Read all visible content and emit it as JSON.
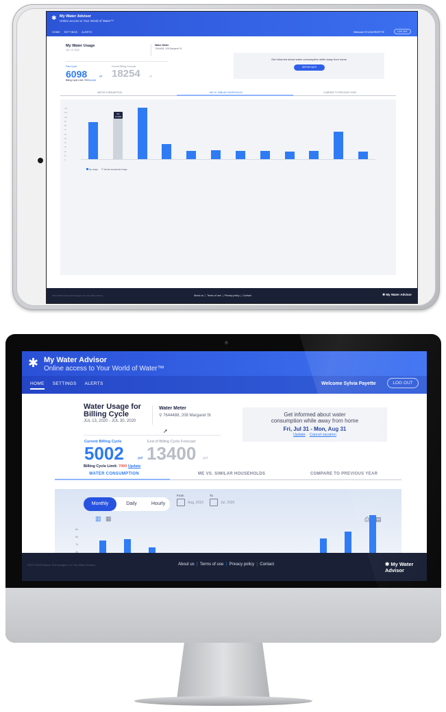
{
  "brand": {
    "app_name": "My Water Advisor",
    "tagline": "Online access to Your World of Water™"
  },
  "nav": {
    "items": [
      "HOME",
      "SETTINGS",
      "ALERTS"
    ],
    "welcome": "Welcome Sylvia Payette",
    "logout": "LOG OUT"
  },
  "usage": {
    "title": "Water Usage for Billing Cycle",
    "title_line1": "Water Usage for",
    "title_line2": "Billing Cycle",
    "date_range": "JUL 13, 2020 - JUL 30, 2020",
    "current_label": "Current Billing Cycle",
    "current_value": "5002",
    "current_unit": "gal",
    "forecast_label": "End of Billing Cycle Forecast",
    "forecast_value": "13400",
    "forecast_unit": "gal",
    "limit_label": "Billing Cycle Limit:",
    "limit_value": "7000",
    "limit_update": "Update"
  },
  "meter": {
    "label": "Water Meter",
    "address": "7644488, 208 Margaret St"
  },
  "vacation": {
    "text_line1": "Get informed about water",
    "text_line2": "consumption while away from home",
    "dates": "Fri, Jul 31 - Mon, Aug 31",
    "update": "Update",
    "cancel": "Cancel vacation"
  },
  "tabs": [
    "WATER CONSUMPTION",
    "ME VS. SIMILAR HOUSEHOLDS",
    "COMPARE TO PREVIOUS YEAR"
  ],
  "filters": {
    "periods": [
      "Monthly",
      "Daily",
      "Hourly"
    ],
    "from_label": "From",
    "from_value": "Aug, 2019",
    "to_label": "To",
    "to_value": "Jul, 2020"
  },
  "monitor_chart": {
    "yticks": [
      "8k",
      "6k",
      "7k",
      "4k"
    ],
    "values": [
      0.28,
      0.3,
      0.12,
      0.0,
      0.0,
      0.0,
      0.0,
      0.0,
      0.0,
      0.32,
      0.48,
      0.85
    ]
  },
  "tablet": {
    "usage_title": "My Water Usage",
    "usage_date": "JUL 13, 2020",
    "meter_label": "Water Meter",
    "meter_address": "7644488, 208 Margaret St",
    "current_label": "Past Cycle",
    "current_value": "6098",
    "forecast_label": "Current Billing Forecast",
    "forecast_value": "18254",
    "unit": "gal",
    "limit": "Billing Cycle Limit: 7000",
    "limit_update": "Update",
    "vacation_text": "Get informed about water consumption while away from home",
    "vacation_btn": "DEFINE DAYS",
    "tabs": [
      "WATER CONSUMPTION",
      "ME VS. SIMILAR HOUSEHOLDS",
      "COMPARE TO PREVIOUS YEAR"
    ],
    "welcome": "Welcome SYLVIA PAYETTE",
    "logout": "LOG OUT",
    "tooltip_title": "Me",
    "tooltip_value": "12,800",
    "chart_values": [
      0.7,
      0.76,
      0.97,
      0.28,
      0.16,
      0.17,
      0.15,
      0.16,
      0.14,
      0.16,
      0.52,
      0.14
    ],
    "chart_yticks": [
      "12k",
      "11k",
      "10k",
      "9k",
      "8k",
      "7k",
      "6k",
      "5k",
      "4k",
      "3k",
      "2k",
      "1k",
      "0"
    ],
    "legend_me": "My usage",
    "legend_avg": "Similar Household Usage"
  },
  "footer": {
    "links": [
      "About us",
      "Terms of use",
      "Privacy policy",
      "Contact"
    ],
    "copyright": "2019 ©2020 Aclara Technologies LLC My Water Advisor",
    "brand": "My Water Advisor"
  }
}
